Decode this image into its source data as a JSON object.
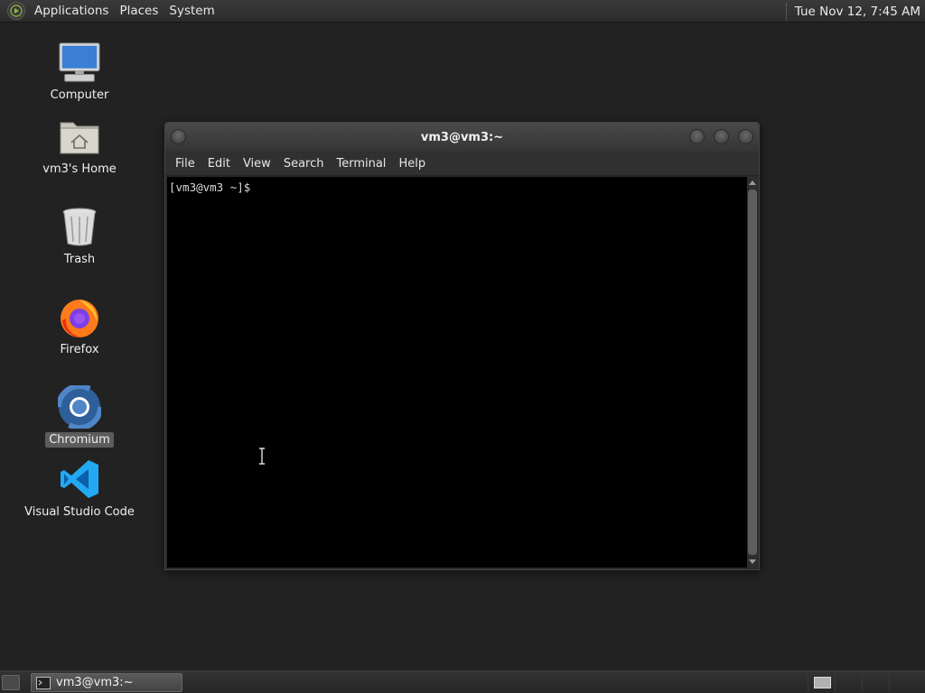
{
  "top_panel": {
    "menus": [
      "Applications",
      "Places",
      "System"
    ],
    "clock": "Tue Nov 12,  7:45 AM"
  },
  "desktop": {
    "icons": [
      {
        "label": "Computer",
        "icon": "computer-icon"
      },
      {
        "label": "vm3's Home",
        "icon": "home-folder-icon"
      },
      {
        "label": "Trash",
        "icon": "trash-icon"
      },
      {
        "label": "Firefox",
        "icon": "firefox-icon"
      },
      {
        "label": "Chromium",
        "icon": "chromium-icon",
        "selected": true
      },
      {
        "label": "Visual Studio Code",
        "icon": "vscode-icon"
      }
    ]
  },
  "terminal": {
    "title": "vm3@vm3:~",
    "menu": [
      "File",
      "Edit",
      "View",
      "Search",
      "Terminal",
      "Help"
    ],
    "prompt": "[vm3@vm3 ~]$"
  },
  "taskbar": {
    "task_label": "vm3@vm3:~"
  },
  "colors": {
    "desktop_bg": "#222222",
    "terminal_bg": "#000000",
    "vscode_blue": "#23a9f2",
    "chromium_blue": "#4f86c6"
  }
}
